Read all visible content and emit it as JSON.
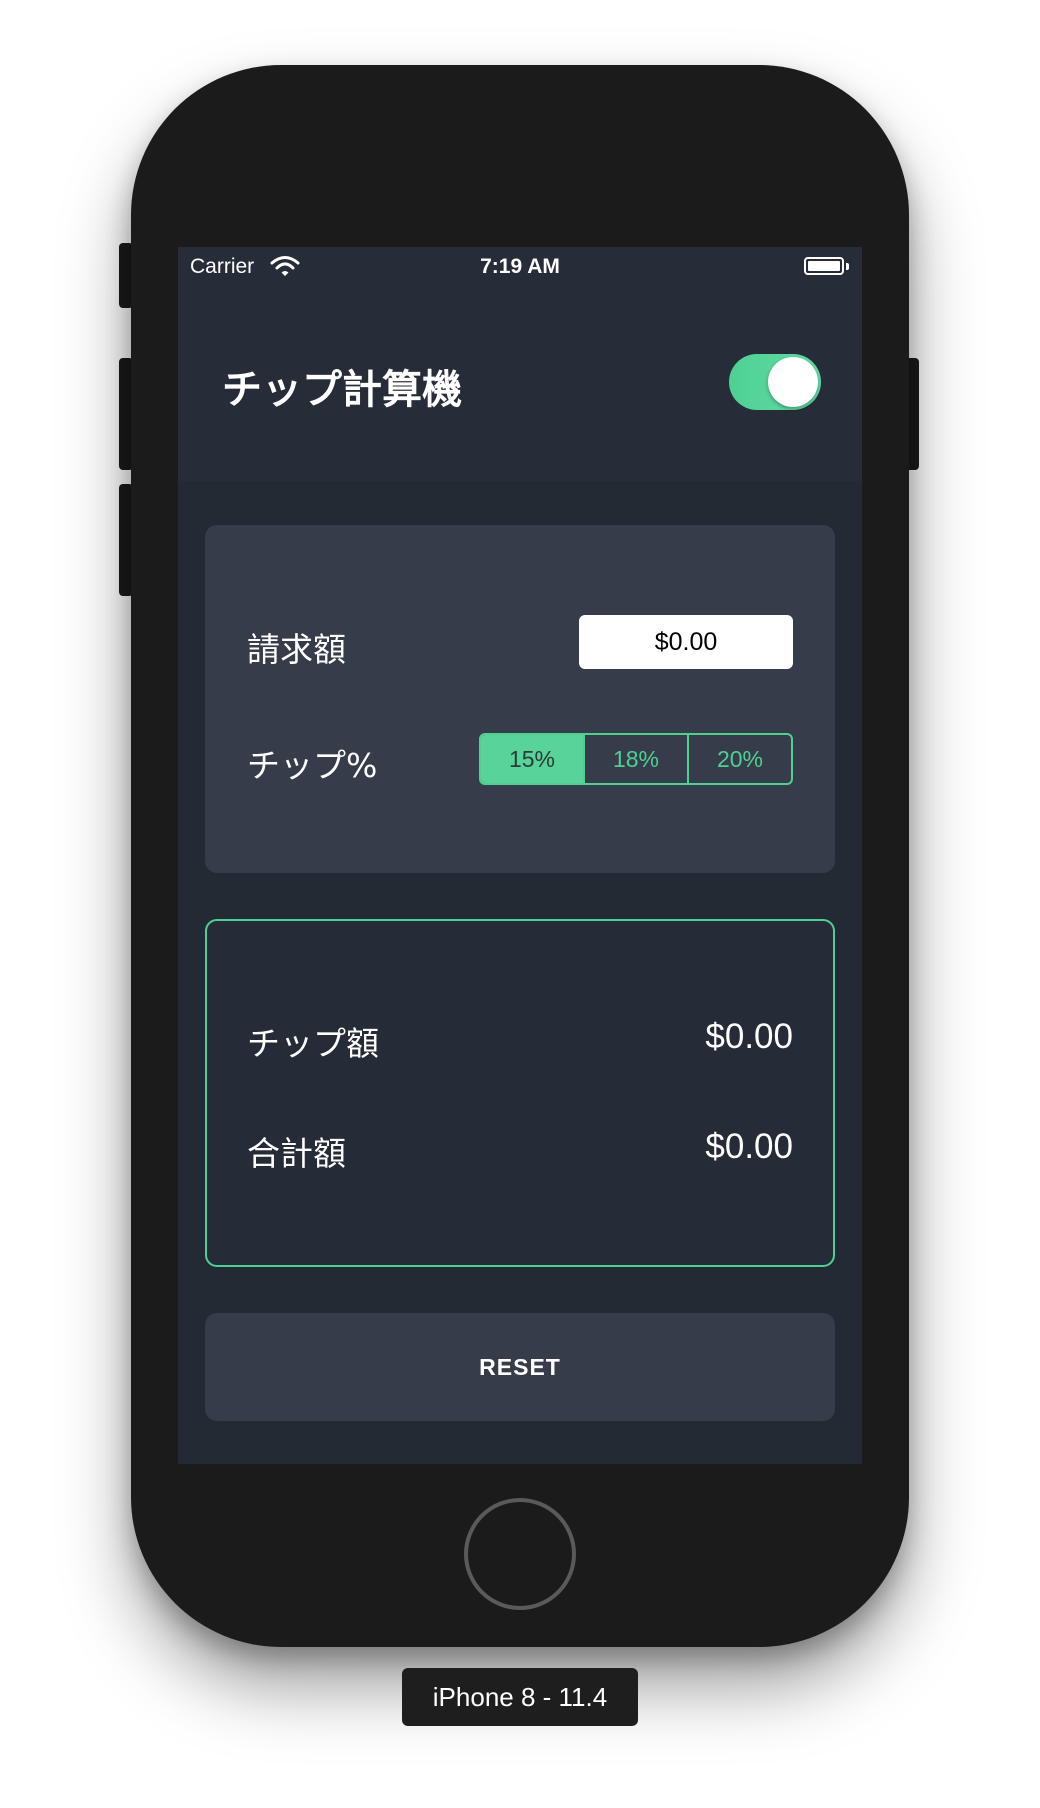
{
  "status_bar": {
    "carrier": "Carrier",
    "time": "7:19 AM"
  },
  "header": {
    "title": "チップ計算機",
    "toggle_on": true
  },
  "input_card": {
    "bill_label": "請求額",
    "bill_value": "$0.00",
    "tip_label": "チップ%",
    "tip_options": [
      "15%",
      "18%",
      "20%"
    ],
    "tip_selected": "15%"
  },
  "result_card": {
    "tip_amount_label": "チップ額",
    "tip_amount_value": "$0.00",
    "total_label": "合計額",
    "total_value": "$0.00"
  },
  "reset_label": "RESET",
  "device_label": "iPhone 8 - 11.4",
  "colors": {
    "accent": "#4fd093",
    "background": "#232a33",
    "card": "#363c49"
  }
}
